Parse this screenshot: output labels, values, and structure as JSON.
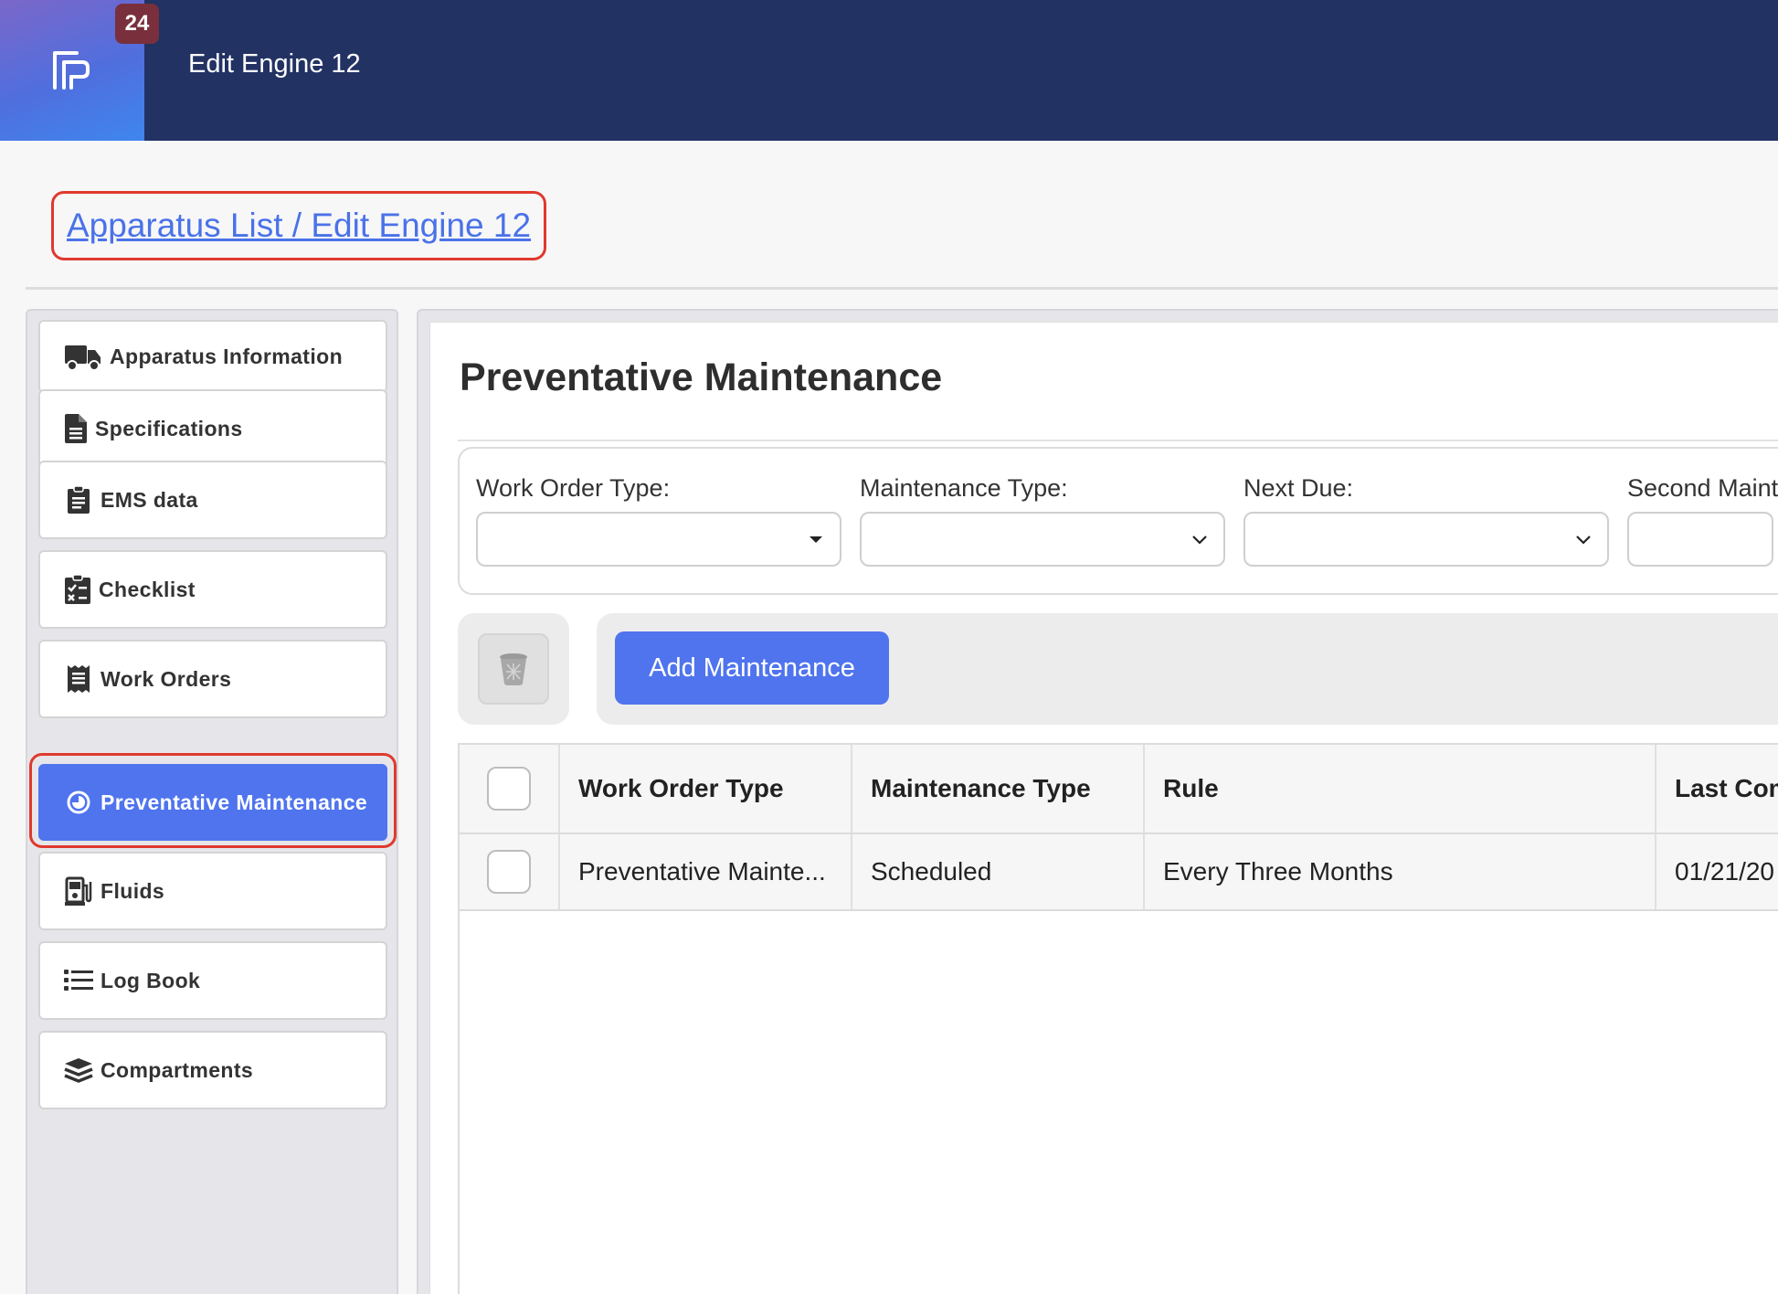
{
  "header": {
    "badge_count": "24",
    "title": "Edit Engine 12"
  },
  "breadcrumb": {
    "text": "Apparatus List / Edit Engine 12"
  },
  "sidebar": {
    "items": [
      {
        "label": "Apparatus Information",
        "icon": "truck-icon"
      },
      {
        "label": "Specifications",
        "icon": "document-icon"
      },
      {
        "label": "EMS data",
        "icon": "clipboard-icon"
      },
      {
        "label": "Checklist",
        "icon": "clipboard-check-icon"
      },
      {
        "label": "Work Orders",
        "icon": "receipt-icon"
      },
      {
        "label": "Preventative Maintenance",
        "icon": "clock-icon",
        "active": true
      },
      {
        "label": "Fluids",
        "icon": "gas-pump-icon"
      },
      {
        "label": "Log Book",
        "icon": "list-icon"
      },
      {
        "label": "Compartments",
        "icon": "layers-icon"
      }
    ]
  },
  "main": {
    "title": "Preventative Maintenance",
    "filters": [
      {
        "label": "Work Order Type:",
        "value": ""
      },
      {
        "label": "Maintenance Type:",
        "value": ""
      },
      {
        "label": "Next Due:",
        "value": ""
      },
      {
        "label": "Second Mainte",
        "value": ""
      }
    ],
    "add_button": "Add Maintenance",
    "table": {
      "columns": [
        "Work Order Type",
        "Maintenance Type",
        "Rule",
        "Last Com"
      ],
      "rows": [
        [
          "Preventative Mainte...",
          "Scheduled",
          "Every Three Months",
          "01/21/20"
        ]
      ]
    }
  },
  "colors": {
    "header_bg": "#223263",
    "accent": "#4f74ee",
    "highlight": "#e0392e",
    "badge": "#7a2f3d"
  }
}
